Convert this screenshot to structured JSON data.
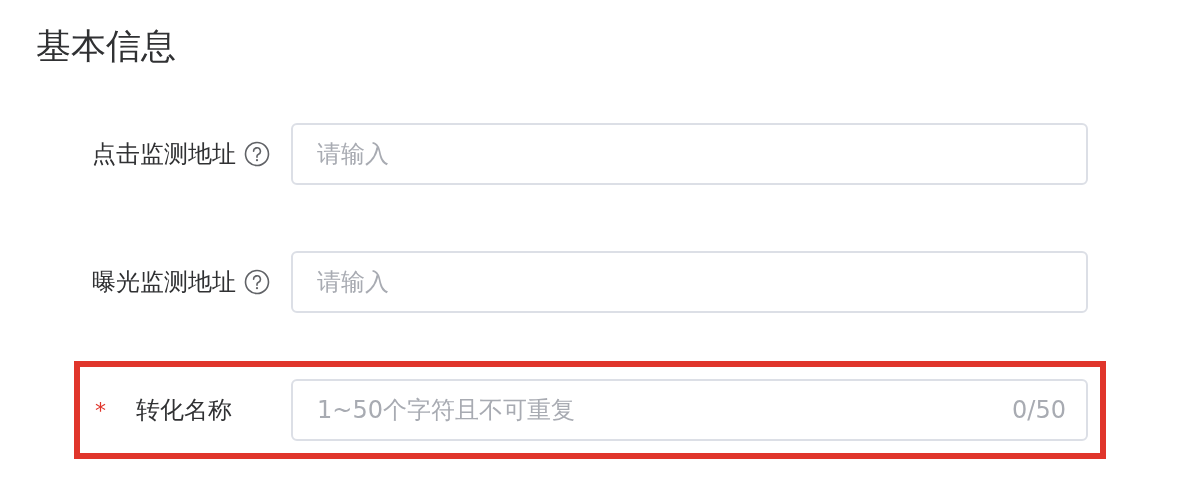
{
  "section_title": "基本信息",
  "fields": [
    {
      "label": "点击监测地址",
      "help": true,
      "placeholder": "请输入",
      "highlighted": false
    },
    {
      "label": "曝光监测地址",
      "help": true,
      "placeholder": "请输入",
      "highlighted": false
    },
    {
      "required_mark": "*",
      "label": "转化名称",
      "help": false,
      "placeholder": "1~50个字符且不可重复",
      "counter": "0/50",
      "highlighted": true
    }
  ]
}
